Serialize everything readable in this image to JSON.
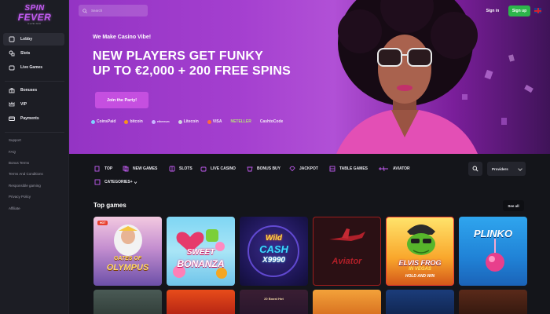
{
  "brand": {
    "line1": "SPIN",
    "line2": "FEVER",
    "line3": "CASINO"
  },
  "sidebar": {
    "items": [
      {
        "label": "Lobby",
        "icon": "lobby-icon"
      },
      {
        "label": "Slots",
        "icon": "slots-icon"
      },
      {
        "label": "Live Games",
        "icon": "live-games-icon"
      },
      {
        "label": "Bonuses",
        "icon": "bonuses-icon"
      },
      {
        "label": "VIP",
        "icon": "vip-crown-icon"
      },
      {
        "label": "Payments",
        "icon": "payments-icon"
      }
    ],
    "links": [
      "Support",
      "FAQ",
      "Bonus Terms",
      "Terms And Conditions",
      "Responsible gaming",
      "Privacy Policy",
      "Affiliate"
    ]
  },
  "header": {
    "search_placeholder": "Search",
    "signin_label": "Sign in",
    "signup_label": "Sign up"
  },
  "hero": {
    "subtitle": "We Make Casino Vibe!",
    "title_line1": "NEW PLAYERS GET FUNKY",
    "title_line2": "UP TO €2,000 + 200 FREE SPINS",
    "cta_label": "Join the Party!",
    "payments": [
      "CoinsPaid",
      "bitcoin",
      "ethereum",
      "Litecoin",
      "VISA",
      "NETELLER",
      "CashtoCode"
    ]
  },
  "categories": {
    "items": [
      "TOP",
      "NEW GAMES",
      "SLOTS",
      "LIVE CASINO",
      "BONUS BUY",
      "JACKPOT",
      "TABLE GAMES",
      "AVIATOR"
    ],
    "more_label": "CATEGORIES+",
    "providers_label": "Providers"
  },
  "top_games": {
    "title": "Top games",
    "see_all_label": "See all",
    "tiles": [
      {
        "line1": "GATES OF",
        "line2": "OLYMPUS",
        "badge": "HOT"
      },
      {
        "line1": "SWEET",
        "line2": "BONANZA"
      },
      {
        "line1": "Wild",
        "line2": "CASH",
        "line3": "X9990"
      },
      {
        "line1": "Aviator"
      },
      {
        "line1": "ELVIS FROG",
        "line2": "IN VEGAS",
        "line3": "HOLD AND WIN"
      },
      {
        "line1": "PLINKO"
      }
    ],
    "row2_text": "20 Boost Hot"
  },
  "colors": {
    "accent": "#c54fe0",
    "signup": "#2db54b",
    "background": "#14151a",
    "sidebar": "#1c1d24"
  }
}
